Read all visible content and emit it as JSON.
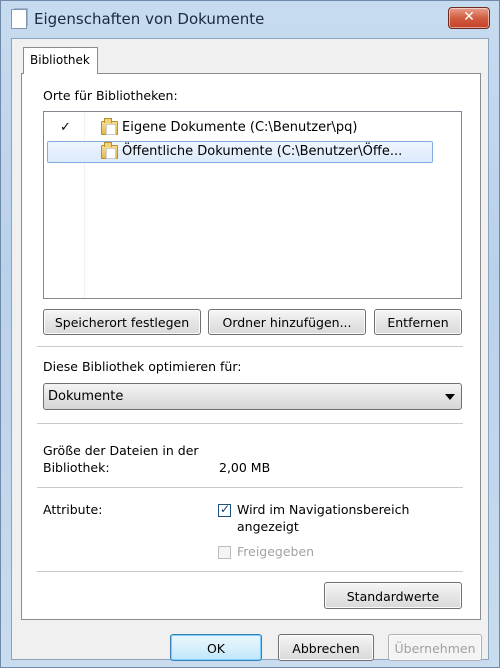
{
  "window": {
    "title": "Eigenschaften von Dokumente",
    "close_label": "✕"
  },
  "tabs": [
    {
      "label": "Bibliothek"
    }
  ],
  "locations": {
    "label": "Orte für Bibliotheken:",
    "items": [
      {
        "check": "✓",
        "text": "Eigene Dokumente (C:\\Benutzer\\pq)",
        "selected": false
      },
      {
        "check": "",
        "text": "Öffentliche Dokumente (C:\\Benutzer\\Öffe...",
        "selected": true
      }
    ]
  },
  "buttons": {
    "set_location": "Speicherort festlegen",
    "add_folder": "Ordner hinzufügen...",
    "remove": "Entfernen",
    "restore_defaults": "Standardwerte",
    "ok": "OK",
    "cancel": "Abbrechen",
    "apply": "Übernehmen"
  },
  "optimize": {
    "label": "Diese Bibliothek optimieren für:",
    "selected": "Dokumente"
  },
  "size": {
    "label_line1": "Größe der Dateien in der",
    "label_line2": "Bibliothek:",
    "value": "2,00 MB"
  },
  "attributes": {
    "label": "Attribute:",
    "nav_line1": "Wird im Navigationsbereich",
    "nav_line2": "angezeigt",
    "nav_checked": true,
    "shared_label": "Freigegeben",
    "shared_checked": false,
    "shared_enabled": false
  }
}
